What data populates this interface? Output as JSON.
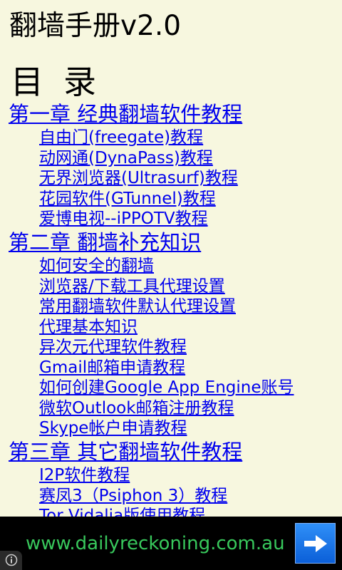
{
  "app": {
    "title": "翻墙手册v2.0"
  },
  "toc": {
    "heading": "目录",
    "chapters": [
      {
        "title": "第一章 经典翻墙软件教程",
        "items": [
          "自由门(freegate)教程",
          "动网通(DynaPass)教程",
          "无界浏览器(Ultrasurf)教程",
          "花园软件(GTunnel)教程",
          "爱博电视--iPPOTV教程"
        ]
      },
      {
        "title": "第二章  翻墙补充知识",
        "items": [
          "如何安全的翻墙",
          "浏览器/下载工具代理设置",
          "常用翻墙软件默认代理设置",
          "代理基本知识",
          "异次元代理软件教程",
          "Gmail邮箱申请教程",
          "如何创建Google App Engine账号",
          "微软Outlook邮箱注册教程",
          "Skype帐户申请教程"
        ]
      },
      {
        "title": "第三章 其它翻墙软件教程",
        "items": [
          "I2P软件教程",
          "赛凤3（Psiphon 3）教程",
          "Tor Vidalia版使用教程"
        ]
      }
    ]
  },
  "ad": {
    "text": "www.dailyreckoning.com.au",
    "button_icon": "arrow-right-icon",
    "info_icon": "info-icon",
    "text_color": "#38c85c",
    "button_color": "#1a73e8"
  }
}
